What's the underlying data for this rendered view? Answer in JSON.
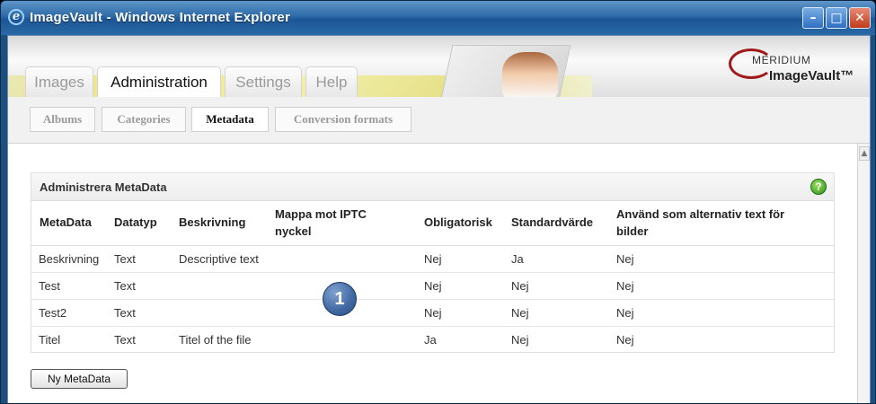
{
  "window": {
    "title": "ImageVault - Windows Internet Explorer",
    "minimize_glyph": "–",
    "maximize_glyph": "□",
    "close_glyph": "✕"
  },
  "brand": {
    "company": "MERIDIUM",
    "product": "ImageVault™",
    "accent_color": "#a11a1a"
  },
  "tabs": [
    {
      "label": "Images",
      "active": false
    },
    {
      "label": "Administration",
      "active": true
    },
    {
      "label": "Settings",
      "active": false
    },
    {
      "label": "Help",
      "active": false
    }
  ],
  "subnav": [
    {
      "label": "Albums",
      "active": false
    },
    {
      "label": "Categories",
      "active": false
    },
    {
      "label": "Metadata",
      "active": true
    },
    {
      "label": "Conversion formats",
      "active": false
    }
  ],
  "panel": {
    "title": "Administrera MetaData",
    "help_glyph": "?",
    "columns": [
      "MetaData",
      "Datatyp",
      "Beskrivning",
      "Mappa mot IPTC nyckel",
      "Obligatorisk",
      "Standardvärde",
      "Använd som alternativ text för bilder"
    ],
    "rows": [
      [
        "Beskrivning",
        "Text",
        "Descriptive text",
        "",
        "Nej",
        "Ja",
        "Nej"
      ],
      [
        "Test",
        "Text",
        "",
        "",
        "Nej",
        "Nej",
        "Nej"
      ],
      [
        "Test2",
        "Text",
        "",
        "",
        "Nej",
        "Nej",
        "Nej"
      ],
      [
        "Titel",
        "Text",
        "Titel of the file",
        "",
        "Ja",
        "Nej",
        "Nej"
      ]
    ]
  },
  "callout": "1",
  "new_button": "Ny MetaData"
}
